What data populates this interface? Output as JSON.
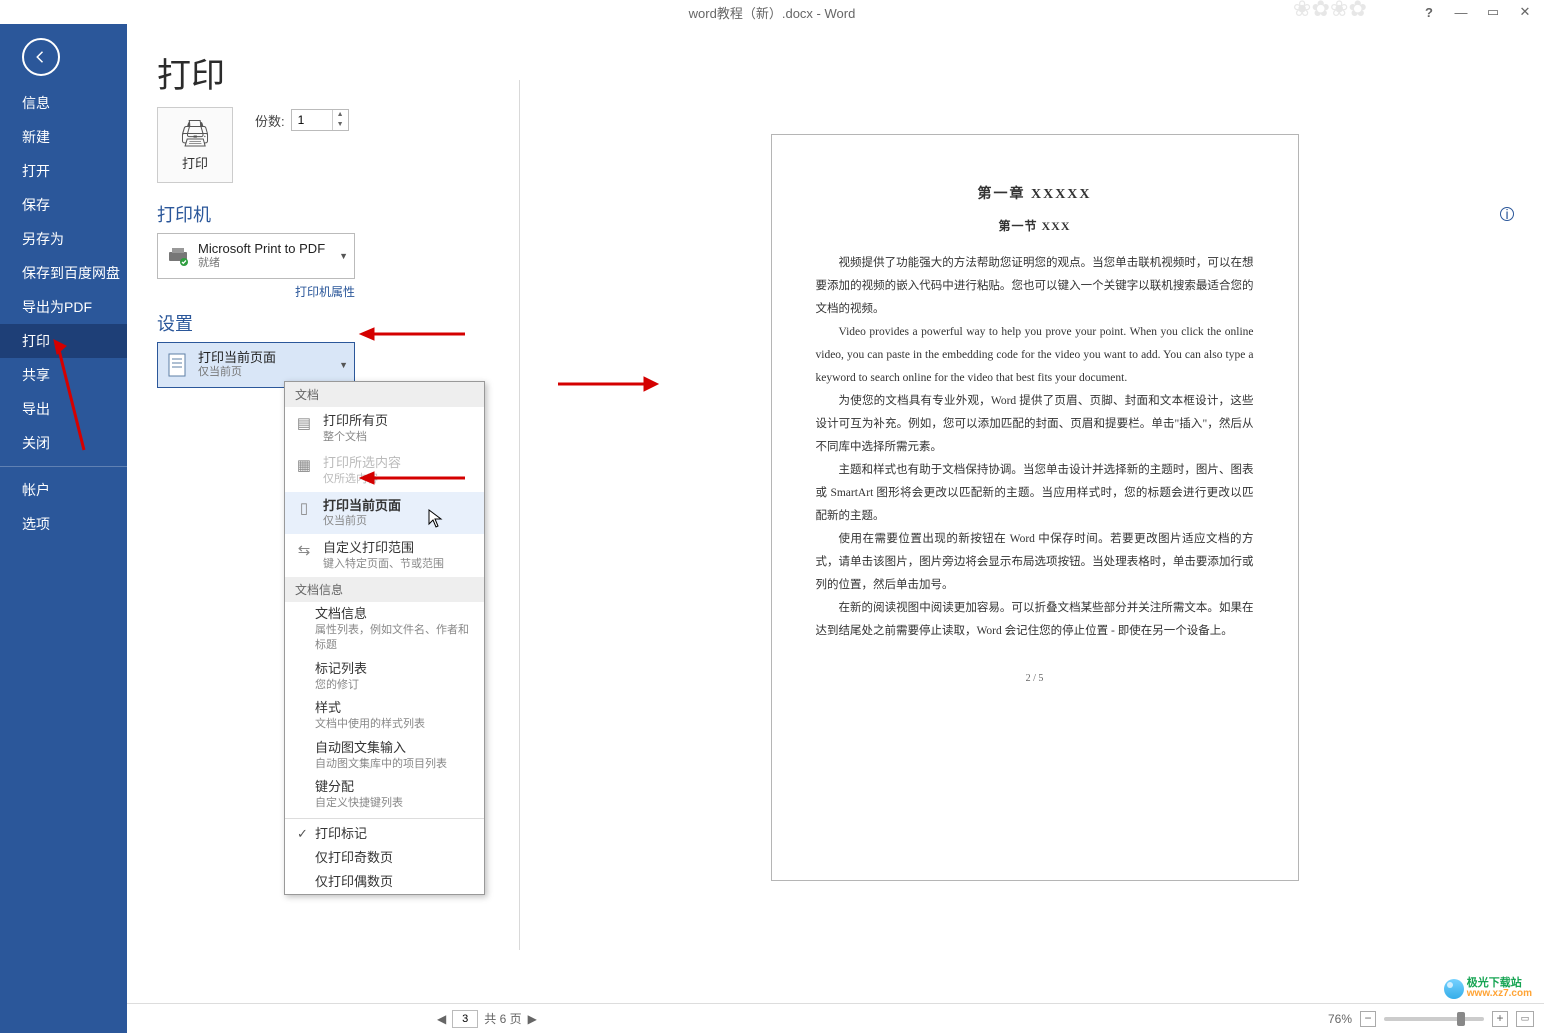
{
  "title": "word教程（新）.docx - Word",
  "window_controls": {
    "help": "?"
  },
  "sidebar": {
    "items": [
      {
        "label": "信息"
      },
      {
        "label": "新建"
      },
      {
        "label": "打开"
      },
      {
        "label": "保存"
      },
      {
        "label": "另存为"
      },
      {
        "label": "保存到百度网盘"
      },
      {
        "label": "导出为PDF"
      },
      {
        "label": "打印"
      },
      {
        "label": "共享"
      },
      {
        "label": "导出"
      },
      {
        "label": "关闭"
      }
    ],
    "items2": [
      {
        "label": "帐户"
      },
      {
        "label": "选项"
      }
    ]
  },
  "page_title": "打印",
  "print_button": "打印",
  "copies": {
    "label": "份数:",
    "value": "1"
  },
  "printer_section": "打印机",
  "printer": {
    "name": "Microsoft Print to PDF",
    "status": "就绪"
  },
  "printer_props": "打印机属性",
  "settings_section": "设置",
  "selected_range": {
    "title": "打印当前页面",
    "sub": "仅当前页"
  },
  "dropdown": {
    "hdr1": "文档",
    "opt_all": {
      "t": "打印所有页",
      "s": "整个文档"
    },
    "opt_sel": {
      "t": "打印所选内容",
      "s": "仅所选内容"
    },
    "opt_cur": {
      "t": "打印当前页面",
      "s": "仅当前页"
    },
    "opt_rng": {
      "t": "自定义打印范围",
      "s": "键入特定页面、节或范围"
    },
    "hdr2": "文档信息",
    "lines": [
      {
        "t": "文档信息",
        "s": "属性列表，例如文件名、作者和标题"
      },
      {
        "t": "标记列表",
        "s": "您的修订"
      },
      {
        "t": "样式",
        "s": "文档中使用的样式列表"
      },
      {
        "t": "自动图文集输入",
        "s": "自动图文集库中的项目列表"
      },
      {
        "t": "键分配",
        "s": "自定义快捷键列表"
      }
    ],
    "tail": [
      "打印标记",
      "仅打印奇数页",
      "仅打印偶数页"
    ]
  },
  "preview": {
    "h1": "第一章  XXXXX",
    "h2": "第一节  XXX",
    "p1": "视频提供了功能强大的方法帮助您证明您的观点。当您单击联机视频时，可以在想要添加的视频的嵌入代码中进行粘贴。您也可以键入一个关键字以联机搜索最适合您的文档的视频。",
    "p2": "Video provides a powerful way to help you prove your point. When you click the online video, you can paste in the embedding code for the video you want to add. You can also type a keyword to search online for the video that best fits your document.",
    "p3": "为使您的文档具有专业外观，Word 提供了页眉、页脚、封面和文本框设计，这些设计可互为补充。例如，您可以添加匹配的封面、页眉和提要栏。单击\"插入\"，然后从不同库中选择所需元素。",
    "p4": "主题和样式也有助于文档保持协调。当您单击设计并选择新的主题时，图片、图表或 SmartArt 图形将会更改以匹配新的主题。当应用样式时，您的标题会进行更改以匹配新的主题。",
    "p5": "使用在需要位置出现的新按钮在 Word 中保存时间。若要更改图片适应文档的方式，请单击该图片，图片旁边将会显示布局选项按钮。当处理表格时，单击要添加行或列的位置，然后单击加号。",
    "p6": "在新的阅读视图中阅读更加容易。可以折叠文档某些部分并关注所需文本。如果在达到结尾处之前需要停止读取，Word 会记住您的停止位置 - 即使在另一个设备上。",
    "pg": "2 / 5"
  },
  "footer": {
    "page_value": "3",
    "total": "共 6 页",
    "zoom": "76%"
  },
  "watermark": {
    "top": "极光下载站",
    "bot": "www.xz7.com"
  }
}
